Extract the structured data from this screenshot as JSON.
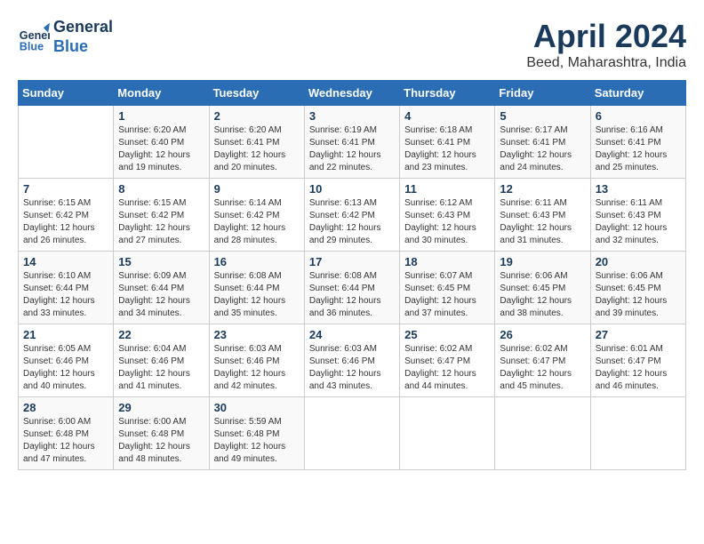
{
  "header": {
    "logo_line1": "General",
    "logo_line2": "Blue",
    "month_title": "April 2024",
    "subtitle": "Beed, Maharashtra, India"
  },
  "weekdays": [
    "Sunday",
    "Monday",
    "Tuesday",
    "Wednesday",
    "Thursday",
    "Friday",
    "Saturday"
  ],
  "weeks": [
    [
      {
        "day": "",
        "sunrise": "",
        "sunset": "",
        "daylight": ""
      },
      {
        "day": "1",
        "sunrise": "Sunrise: 6:20 AM",
        "sunset": "Sunset: 6:40 PM",
        "daylight": "Daylight: 12 hours and 19 minutes."
      },
      {
        "day": "2",
        "sunrise": "Sunrise: 6:20 AM",
        "sunset": "Sunset: 6:41 PM",
        "daylight": "Daylight: 12 hours and 20 minutes."
      },
      {
        "day": "3",
        "sunrise": "Sunrise: 6:19 AM",
        "sunset": "Sunset: 6:41 PM",
        "daylight": "Daylight: 12 hours and 22 minutes."
      },
      {
        "day": "4",
        "sunrise": "Sunrise: 6:18 AM",
        "sunset": "Sunset: 6:41 PM",
        "daylight": "Daylight: 12 hours and 23 minutes."
      },
      {
        "day": "5",
        "sunrise": "Sunrise: 6:17 AM",
        "sunset": "Sunset: 6:41 PM",
        "daylight": "Daylight: 12 hours and 24 minutes."
      },
      {
        "day": "6",
        "sunrise": "Sunrise: 6:16 AM",
        "sunset": "Sunset: 6:41 PM",
        "daylight": "Daylight: 12 hours and 25 minutes."
      }
    ],
    [
      {
        "day": "7",
        "sunrise": "Sunrise: 6:15 AM",
        "sunset": "Sunset: 6:42 PM",
        "daylight": "Daylight: 12 hours and 26 minutes."
      },
      {
        "day": "8",
        "sunrise": "Sunrise: 6:15 AM",
        "sunset": "Sunset: 6:42 PM",
        "daylight": "Daylight: 12 hours and 27 minutes."
      },
      {
        "day": "9",
        "sunrise": "Sunrise: 6:14 AM",
        "sunset": "Sunset: 6:42 PM",
        "daylight": "Daylight: 12 hours and 28 minutes."
      },
      {
        "day": "10",
        "sunrise": "Sunrise: 6:13 AM",
        "sunset": "Sunset: 6:42 PM",
        "daylight": "Daylight: 12 hours and 29 minutes."
      },
      {
        "day": "11",
        "sunrise": "Sunrise: 6:12 AM",
        "sunset": "Sunset: 6:43 PM",
        "daylight": "Daylight: 12 hours and 30 minutes."
      },
      {
        "day": "12",
        "sunrise": "Sunrise: 6:11 AM",
        "sunset": "Sunset: 6:43 PM",
        "daylight": "Daylight: 12 hours and 31 minutes."
      },
      {
        "day": "13",
        "sunrise": "Sunrise: 6:11 AM",
        "sunset": "Sunset: 6:43 PM",
        "daylight": "Daylight: 12 hours and 32 minutes."
      }
    ],
    [
      {
        "day": "14",
        "sunrise": "Sunrise: 6:10 AM",
        "sunset": "Sunset: 6:44 PM",
        "daylight": "Daylight: 12 hours and 33 minutes."
      },
      {
        "day": "15",
        "sunrise": "Sunrise: 6:09 AM",
        "sunset": "Sunset: 6:44 PM",
        "daylight": "Daylight: 12 hours and 34 minutes."
      },
      {
        "day": "16",
        "sunrise": "Sunrise: 6:08 AM",
        "sunset": "Sunset: 6:44 PM",
        "daylight": "Daylight: 12 hours and 35 minutes."
      },
      {
        "day": "17",
        "sunrise": "Sunrise: 6:08 AM",
        "sunset": "Sunset: 6:44 PM",
        "daylight": "Daylight: 12 hours and 36 minutes."
      },
      {
        "day": "18",
        "sunrise": "Sunrise: 6:07 AM",
        "sunset": "Sunset: 6:45 PM",
        "daylight": "Daylight: 12 hours and 37 minutes."
      },
      {
        "day": "19",
        "sunrise": "Sunrise: 6:06 AM",
        "sunset": "Sunset: 6:45 PM",
        "daylight": "Daylight: 12 hours and 38 minutes."
      },
      {
        "day": "20",
        "sunrise": "Sunrise: 6:06 AM",
        "sunset": "Sunset: 6:45 PM",
        "daylight": "Daylight: 12 hours and 39 minutes."
      }
    ],
    [
      {
        "day": "21",
        "sunrise": "Sunrise: 6:05 AM",
        "sunset": "Sunset: 6:46 PM",
        "daylight": "Daylight: 12 hours and 40 minutes."
      },
      {
        "day": "22",
        "sunrise": "Sunrise: 6:04 AM",
        "sunset": "Sunset: 6:46 PM",
        "daylight": "Daylight: 12 hours and 41 minutes."
      },
      {
        "day": "23",
        "sunrise": "Sunrise: 6:03 AM",
        "sunset": "Sunset: 6:46 PM",
        "daylight": "Daylight: 12 hours and 42 minutes."
      },
      {
        "day": "24",
        "sunrise": "Sunrise: 6:03 AM",
        "sunset": "Sunset: 6:46 PM",
        "daylight": "Daylight: 12 hours and 43 minutes."
      },
      {
        "day": "25",
        "sunrise": "Sunrise: 6:02 AM",
        "sunset": "Sunset: 6:47 PM",
        "daylight": "Daylight: 12 hours and 44 minutes."
      },
      {
        "day": "26",
        "sunrise": "Sunrise: 6:02 AM",
        "sunset": "Sunset: 6:47 PM",
        "daylight": "Daylight: 12 hours and 45 minutes."
      },
      {
        "day": "27",
        "sunrise": "Sunrise: 6:01 AM",
        "sunset": "Sunset: 6:47 PM",
        "daylight": "Daylight: 12 hours and 46 minutes."
      }
    ],
    [
      {
        "day": "28",
        "sunrise": "Sunrise: 6:00 AM",
        "sunset": "Sunset: 6:48 PM",
        "daylight": "Daylight: 12 hours and 47 minutes."
      },
      {
        "day": "29",
        "sunrise": "Sunrise: 6:00 AM",
        "sunset": "Sunset: 6:48 PM",
        "daylight": "Daylight: 12 hours and 48 minutes."
      },
      {
        "day": "30",
        "sunrise": "Sunrise: 5:59 AM",
        "sunset": "Sunset: 6:48 PM",
        "daylight": "Daylight: 12 hours and 49 minutes."
      },
      {
        "day": "",
        "sunrise": "",
        "sunset": "",
        "daylight": ""
      },
      {
        "day": "",
        "sunrise": "",
        "sunset": "",
        "daylight": ""
      },
      {
        "day": "",
        "sunrise": "",
        "sunset": "",
        "daylight": ""
      },
      {
        "day": "",
        "sunrise": "",
        "sunset": "",
        "daylight": ""
      }
    ]
  ]
}
